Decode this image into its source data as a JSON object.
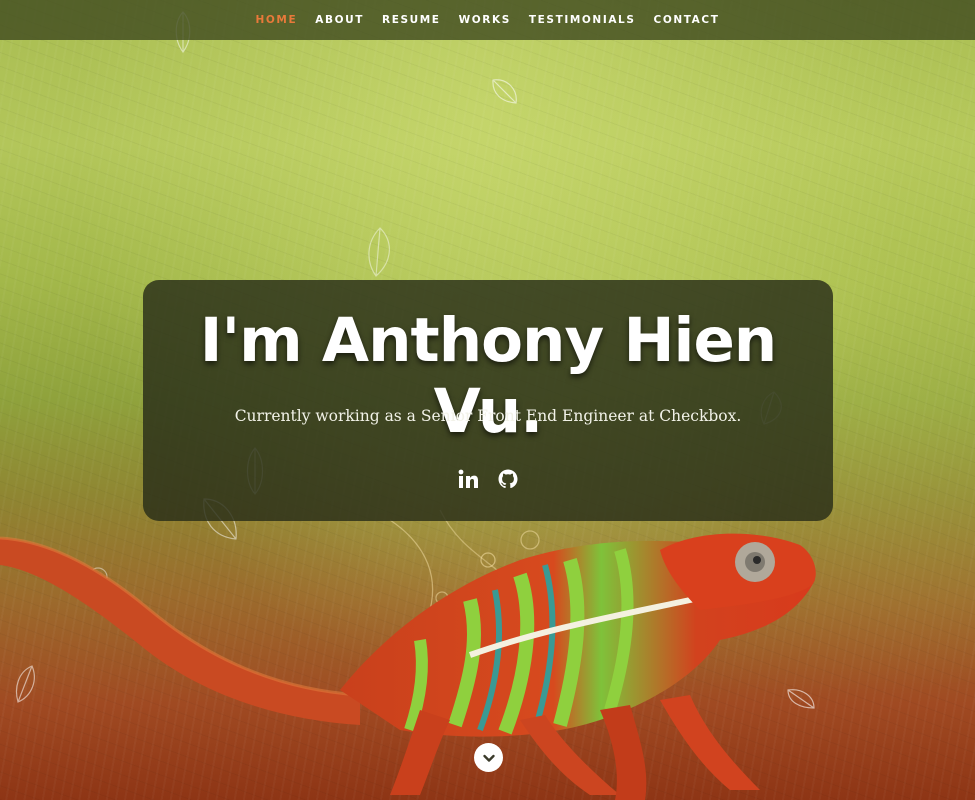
{
  "nav": {
    "items": [
      {
        "label": "HOME",
        "active": true
      },
      {
        "label": "ABOUT",
        "active": false
      },
      {
        "label": "RESUME",
        "active": false
      },
      {
        "label": "WORKS",
        "active": false
      },
      {
        "label": "TESTIMONIALS",
        "active": false
      },
      {
        "label": "CONTACT",
        "active": false
      }
    ],
    "active_color": "#e8793a"
  },
  "banner": {
    "headline": "I'm Anthony Hien Vu.",
    "tagline": "Currently working as a Senior Front End Engineer at Checkbox.",
    "social": [
      {
        "icon": "linkedin-icon"
      },
      {
        "icon": "github-icon"
      }
    ]
  },
  "scroll": {
    "icon": "chevron-down-icon"
  },
  "colors": {
    "banner_bg": "#2d3219",
    "text": "#ffffff",
    "background_top": "#a9bd52",
    "background_bottom": "#8e3515"
  }
}
